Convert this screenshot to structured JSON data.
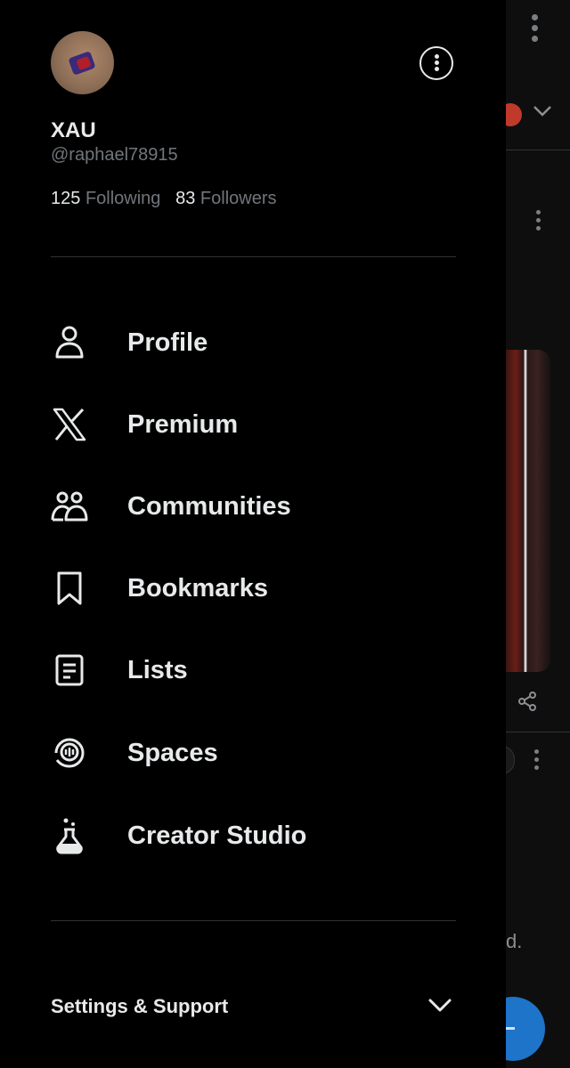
{
  "profile": {
    "display_name": "XAU",
    "handle": "@raphael78915",
    "following_count": "125",
    "following_label": "Following",
    "followers_count": "83",
    "followers_label": "Followers"
  },
  "menu": {
    "items": [
      {
        "label": "Profile",
        "icon": "person-icon"
      },
      {
        "label": "Premium",
        "icon": "x-logo-icon"
      },
      {
        "label": "Communities",
        "icon": "communities-icon"
      },
      {
        "label": "Bookmarks",
        "icon": "bookmark-icon"
      },
      {
        "label": "Lists",
        "icon": "list-icon"
      },
      {
        "label": "Spaces",
        "icon": "spaces-icon"
      },
      {
        "label": "Creator Studio",
        "icon": "flask-icon"
      }
    ]
  },
  "settings": {
    "label": "Settings & Support"
  },
  "background": {
    "partial_text": "d."
  },
  "colors": {
    "background": "#000000",
    "text_primary": "#e7e9ea",
    "text_secondary": "#71767b",
    "divider": "#2f3336",
    "fab": "#1d74c9"
  }
}
